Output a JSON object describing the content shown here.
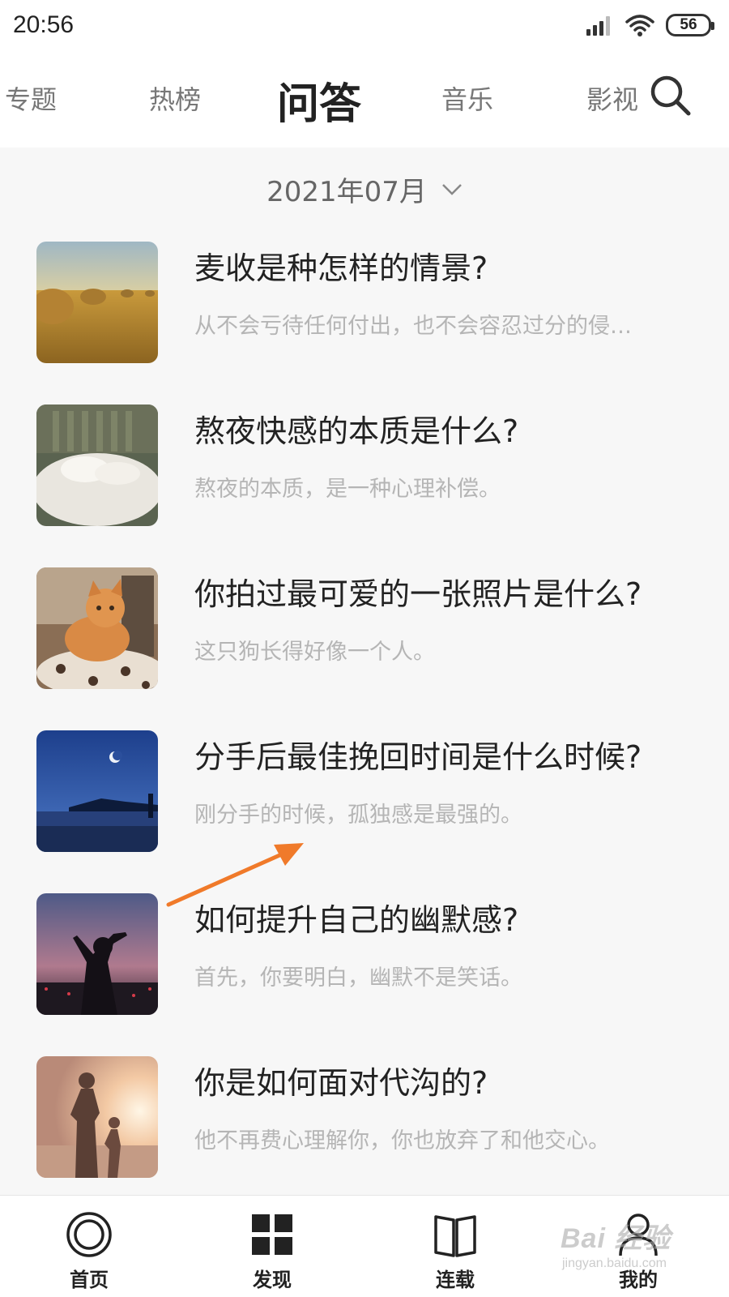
{
  "status_bar": {
    "time": "20:56",
    "battery": "56"
  },
  "top_nav": {
    "tabs": [
      {
        "label": "专题"
      },
      {
        "label": "热榜"
      },
      {
        "label": "问答",
        "active": true
      },
      {
        "label": "音乐"
      },
      {
        "label": "影视"
      }
    ]
  },
  "date_selector": {
    "value": "2021年07月"
  },
  "qa_items": [
    {
      "title": "麦收是种怎样的情景?",
      "summary": "从不会亏待任何付出，也不会容忍过分的侵…"
    },
    {
      "title": "熬夜快感的本质是什么?",
      "summary": "熬夜的本质，是一种心理补偿。"
    },
    {
      "title": "你拍过最可爱的一张照片是什么?",
      "summary": "这只狗长得好像一个人。"
    },
    {
      "title": "分手后最佳挽回时间是什么时候?",
      "summary": "刚分手的时候，孤独感是最强的。"
    },
    {
      "title": "如何提升自己的幽默感?",
      "summary": "首先，你要明白，幽默不是笑话。"
    },
    {
      "title": "你是如何面对代沟的?",
      "summary": "他不再费心理解你，你也放弃了和他交心。"
    }
  ],
  "tab_bar": {
    "items": [
      {
        "label": "首页",
        "icon": "home-circle-icon"
      },
      {
        "label": "发现",
        "icon": "grid-icon"
      },
      {
        "label": "连载",
        "icon": "book-icon"
      },
      {
        "label": "我的",
        "icon": "person-icon"
      }
    ]
  },
  "watermark": {
    "text": "Bai 经验",
    "sub": "jingyan.baidu.com"
  },
  "colors": {
    "background": "#f7f7f7",
    "text_primary": "#222222",
    "text_secondary": "#b5b5b5",
    "annotation_arrow": "#f07a2a"
  }
}
